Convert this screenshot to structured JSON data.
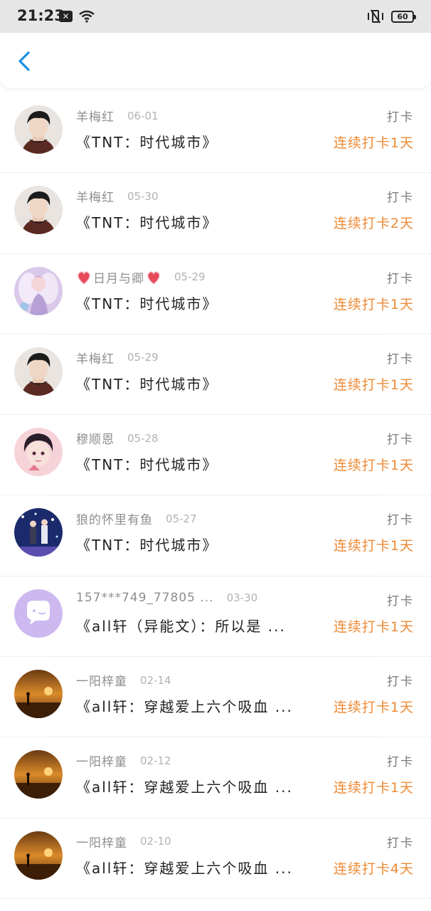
{
  "status_bar": {
    "time": "21:23",
    "battery": "60"
  },
  "header": {
    "back_icon": "chevron-left-icon"
  },
  "items": [
    {
      "name": "羊梅红",
      "date": "06-01",
      "title": "《TNT：时代城市》",
      "checkin": "打卡",
      "streak": "连续打卡1天",
      "avatar": "boy-portrait"
    },
    {
      "name": "羊梅红",
      "date": "05-30",
      "title": "《TNT：时代城市》",
      "checkin": "打卡",
      "streak": "连续打卡2天",
      "avatar": "boy-portrait"
    },
    {
      "name": "日月与卿",
      "date": "05-29",
      "title": "《TNT：时代城市》",
      "checkin": "打卡",
      "streak": "连续打卡1天",
      "avatar": "angel-illustration",
      "hearts": true
    },
    {
      "name": "羊梅红",
      "date": "05-29",
      "title": "《TNT：时代城市》",
      "checkin": "打卡",
      "streak": "连续打卡1天",
      "avatar": "boy-portrait"
    },
    {
      "name": "穆顺恩",
      "date": "05-28",
      "title": "《TNT：时代城市》",
      "checkin": "打卡",
      "streak": "连续打卡1天",
      "avatar": "anime-boy"
    },
    {
      "name": "狼的怀里有鱼",
      "date": "05-27",
      "title": "《TNT：时代城市》",
      "checkin": "打卡",
      "streak": "连续打卡1天",
      "avatar": "stage-performers"
    },
    {
      "name": "157***749_77805 ...",
      "date": "03-30",
      "title": "《all轩（异能文）：所以是 ...",
      "checkin": "打卡",
      "streak": "连续打卡1天",
      "avatar": "default-chat"
    },
    {
      "name": "一阳梓童",
      "date": "02-14",
      "title": "《all轩：穿越爱上六个吸血 ...",
      "checkin": "打卡",
      "streak": "连续打卡1天",
      "avatar": "sunset-silhouette"
    },
    {
      "name": "一阳梓童",
      "date": "02-12",
      "title": "《all轩：穿越爱上六个吸血 ...",
      "checkin": "打卡",
      "streak": "连续打卡1天",
      "avatar": "sunset-silhouette"
    },
    {
      "name": "一阳梓童",
      "date": "02-10",
      "title": "《all轩：穿越爱上六个吸血 ...",
      "checkin": "打卡",
      "streak": "连续打卡4天",
      "avatar": "sunset-silhouette"
    }
  ],
  "colors": {
    "accent": "#1a8fe0",
    "streak": "#ee8a35",
    "status_bg": "#e6e6e6"
  }
}
